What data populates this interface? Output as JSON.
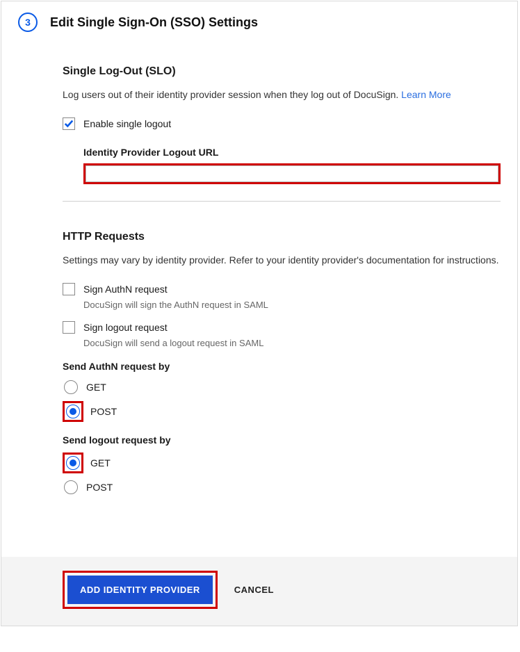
{
  "step": "3",
  "title": "Edit Single Sign-On (SSO) Settings",
  "slo": {
    "heading": "Single Log-Out (SLO)",
    "desc": "Log users out of their identity provider session when they log out of DocuSign. ",
    "learn_more": "Learn More",
    "enable_label": "Enable single logout",
    "logout_url_label": "Identity Provider Logout URL",
    "logout_url_value": ""
  },
  "http": {
    "heading": "HTTP Requests",
    "desc": "Settings may vary by identity provider. Refer to your identity provider's documentation for instructions.",
    "sign_authn_label": "Sign AuthN request",
    "sign_authn_sub": "DocuSign will sign the AuthN request in SAML",
    "sign_logout_label": "Sign logout request",
    "sign_logout_sub": "DocuSign will send a logout request in SAML",
    "send_authn_heading": "Send AuthN request by",
    "send_logout_heading": "Send logout request by",
    "get_label": "GET",
    "post_label": "POST"
  },
  "footer": {
    "primary": "ADD IDENTITY PROVIDER",
    "cancel": "CANCEL"
  }
}
